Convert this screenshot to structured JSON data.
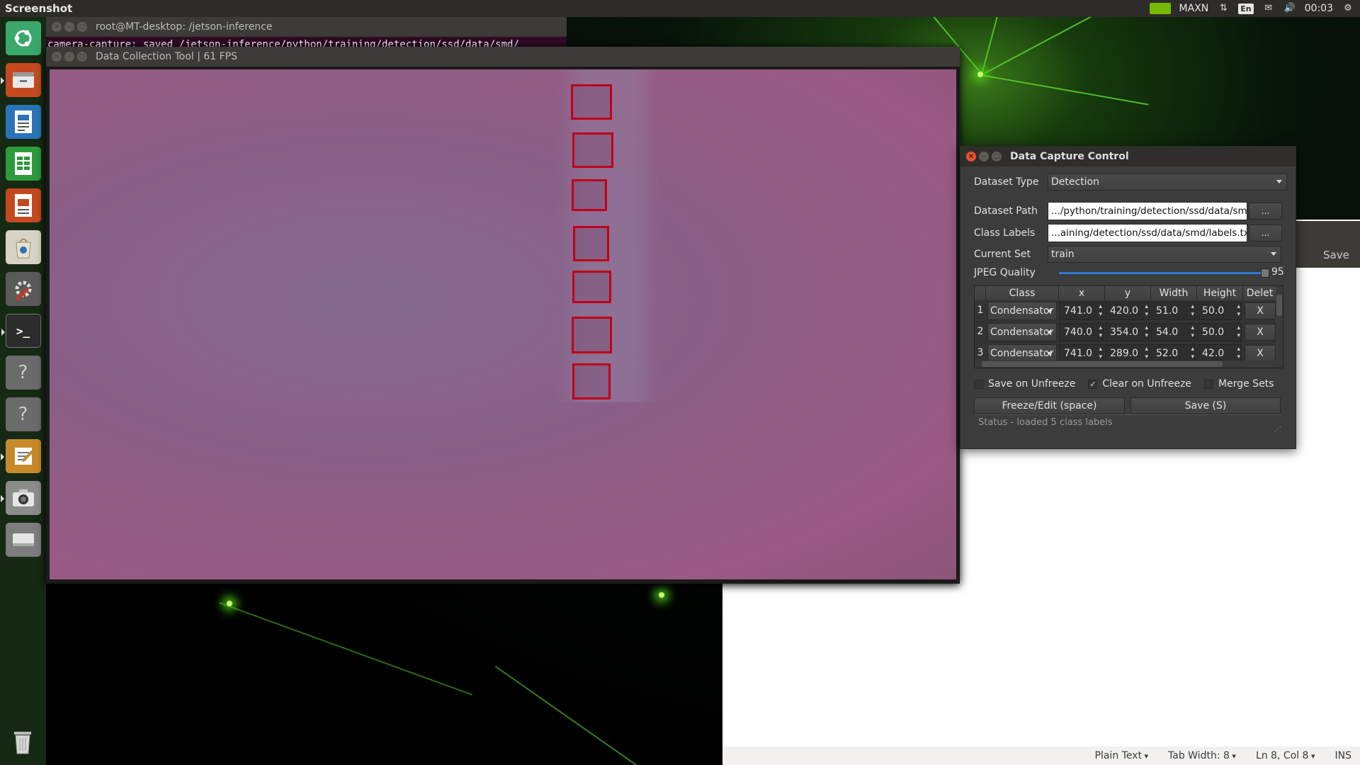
{
  "top_panel": {
    "app_title": "Screenshot",
    "power_mode": "MAXN",
    "language": "En",
    "clock": "00:03",
    "icons": [
      "nvidia-icon",
      "network-icon",
      "mail-icon",
      "volume-icon",
      "gear-icon"
    ]
  },
  "launcher": {
    "items": [
      "ubuntu-icon",
      "files-icon",
      "writer-icon",
      "calc-icon",
      "impress-icon",
      "software-center-icon",
      "system-settings-icon",
      "terminal-icon",
      "unknown-app-icon",
      "unknown-app-icon",
      "text-editor-icon",
      "camera-icon",
      "disk-icon",
      "trash-icon"
    ]
  },
  "terminal": {
    "title": "root@MT-desktop: /jetson-inference",
    "line": "camera-capture:  saved /jetson-inference/python/training/detection/ssd/data/smd/"
  },
  "data_collection_tool": {
    "title": "Data Collection Tool | 61 FPS"
  },
  "editor": {
    "save_label": "Save",
    "status": {
      "language": "Plain Text",
      "tab_width": "Tab Width: 8",
      "position": "Ln 8, Col 8",
      "mode": "INS"
    }
  },
  "data_capture_control": {
    "title": "Data Capture Control",
    "dataset_type_label": "Dataset Type",
    "dataset_type_value": "Detection",
    "dataset_path_label": "Dataset Path",
    "dataset_path_value": ".../python/training/detection/ssd/data/smd",
    "class_labels_label": "Class Labels",
    "class_labels_value": "...aining/detection/ssd/data/smd/labels.txt",
    "browse_label": "...",
    "current_set_label": "Current Set",
    "current_set_value": "train",
    "jpeg_quality_label": "JPEG Quality",
    "jpeg_quality_value": "95",
    "table": {
      "headers": [
        "Class",
        "x",
        "y",
        "Width",
        "Height",
        "Delet"
      ],
      "rows": [
        {
          "num": "1",
          "class": "Condensator",
          "x": "741.0",
          "y": "420.0",
          "width": "51.0",
          "height": "50.0",
          "delete": "X"
        },
        {
          "num": "2",
          "class": "Condensator",
          "x": "740.0",
          "y": "354.0",
          "width": "54.0",
          "height": "50.0",
          "delete": "X"
        },
        {
          "num": "3",
          "class": "Condensator",
          "x": "741.0",
          "y": "289.0",
          "width": "52.0",
          "height": "42.0",
          "delete": "X"
        }
      ]
    },
    "save_on_unfreeze_label": "Save on Unfreeze",
    "clear_on_unfreeze_label": "Clear on Unfreeze",
    "merge_sets_label": "Merge Sets",
    "checks": {
      "save_on_unfreeze": false,
      "clear_on_unfreeze": true,
      "merge_sets": false
    },
    "freeze_button": "Freeze/Edit (space)",
    "save_button": "Save (S)",
    "status": "Status - loaded 5 class labels"
  },
  "colors": {
    "bbox": "#c00018",
    "accent": "#2b7bd6",
    "nvidia_green": "#76b900"
  }
}
